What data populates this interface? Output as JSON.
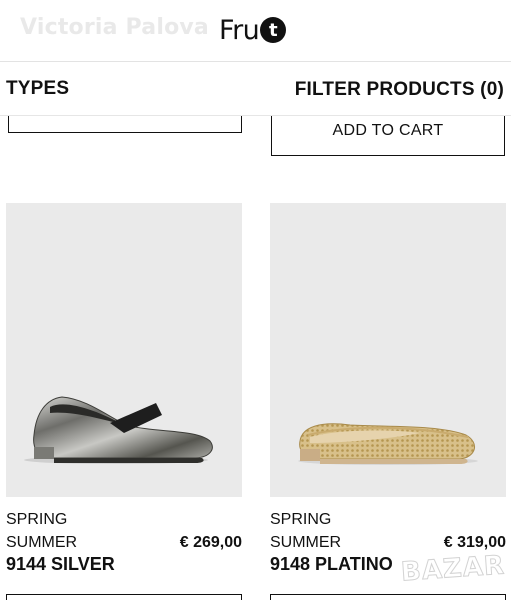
{
  "header": {
    "brand_text": "Victoria Palova",
    "logo": {
      "text": "Fru",
      "circle_letter": "t"
    }
  },
  "filter_bar": {
    "types_label": "TYPES",
    "filter_label": "FILTER PRODUCTS (0)"
  },
  "top_row": {
    "add_to_cart_label": "ADD TO CART"
  },
  "products": [
    {
      "season_line1": "SPRING",
      "season_line2": "SUMMER",
      "price": "€ 269,00",
      "model": "9144 SILVER",
      "image_icon": "silver-ballet-flat-shoe"
    },
    {
      "season_line1": "SPRING",
      "season_line2": "SUMMER",
      "price": "€ 319,00",
      "model": "9148 PLATINO",
      "image_icon": "gold-mesh-ballet-flat-shoe"
    }
  ],
  "watermark": "BAZAR",
  "colors": {
    "text": "#111111",
    "image_bg": "#eaeaea",
    "brand_ghost": "#e9e9e9"
  }
}
